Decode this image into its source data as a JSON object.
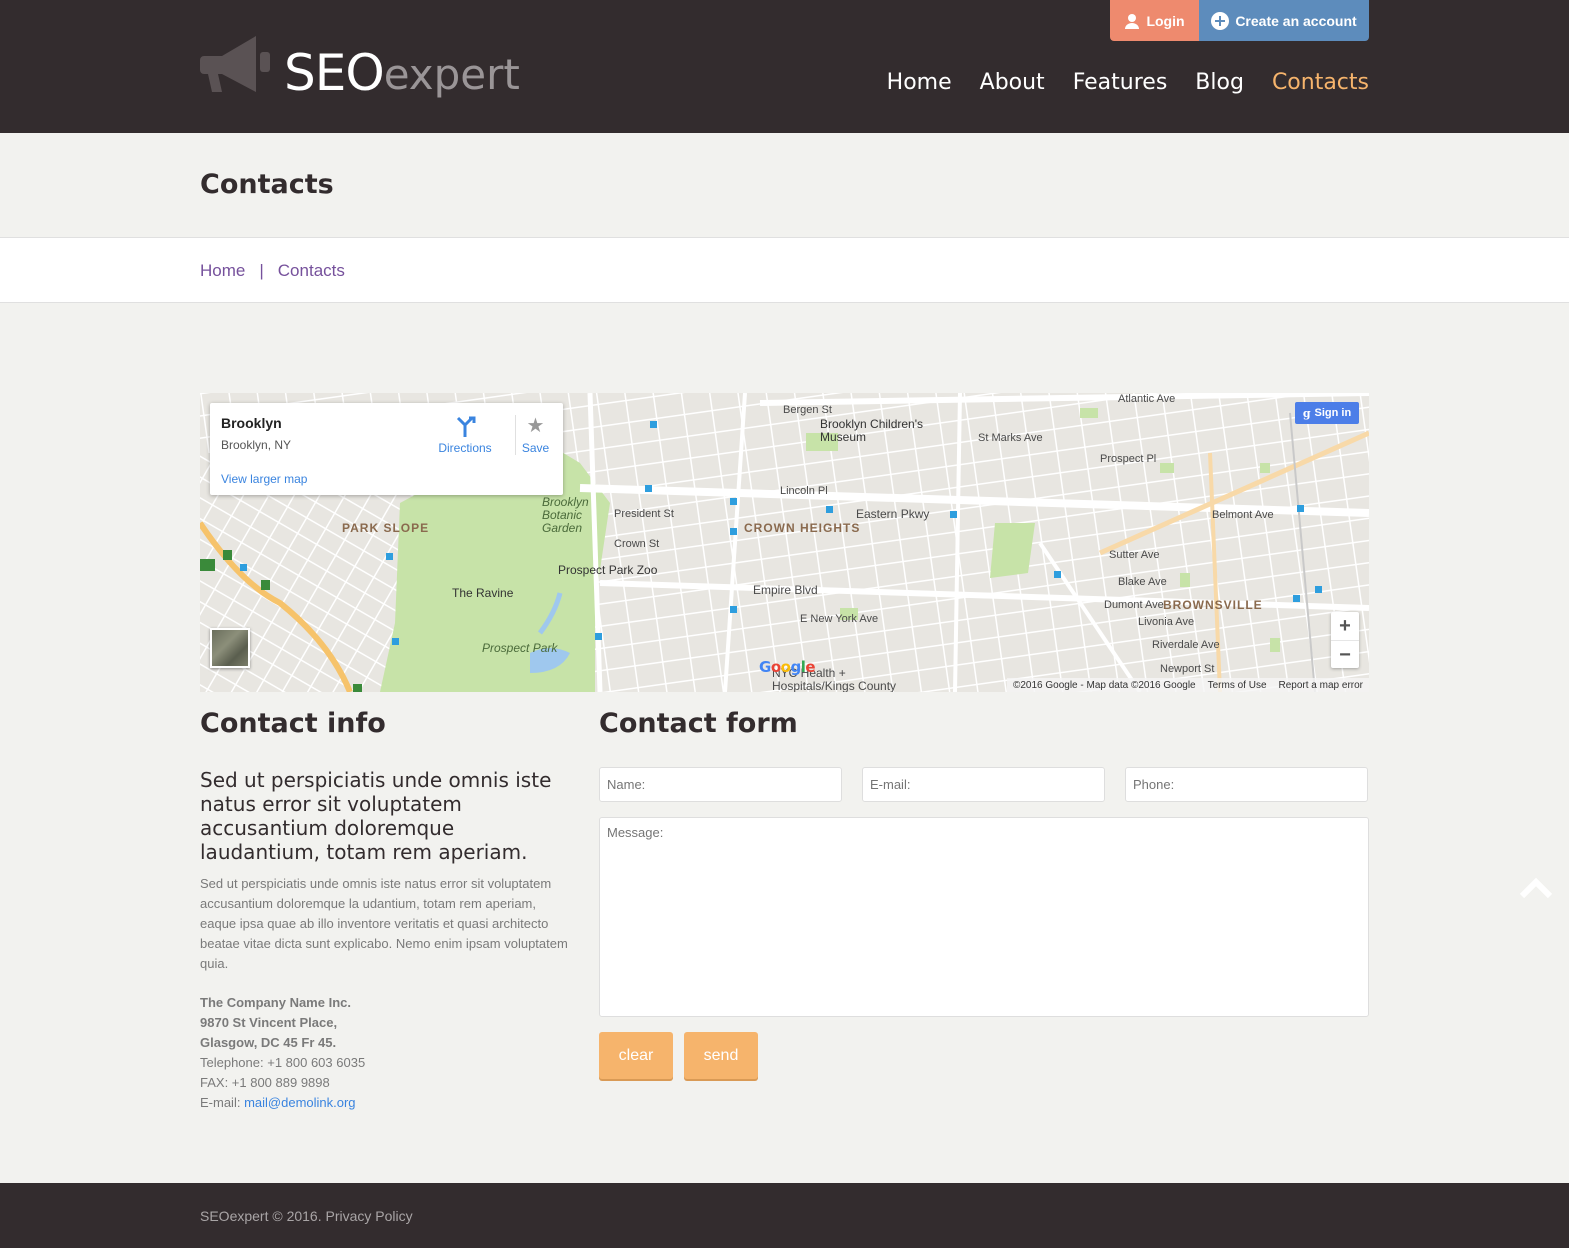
{
  "header": {
    "logo_main": "SEO",
    "logo_sub": "expert",
    "login_label": "Login",
    "create_account_label": "Create an account",
    "nav": [
      "Home",
      "About",
      "Features",
      "Blog",
      "Contacts"
    ],
    "active_nav": "Contacts",
    "colors": {
      "bg": "#332c2e",
      "active": "#f6b46c",
      "login": "#ee8a6e",
      "create": "#5d8cbc"
    }
  },
  "page": {
    "title": "Contacts",
    "breadcrumb": [
      "Home",
      "Contacts"
    ],
    "breadcrumb_separator": "|"
  },
  "map": {
    "place_title": "Brooklyn",
    "place_subtitle": "Brooklyn, NY",
    "directions_label": "Directions",
    "save_label": "Save",
    "larger_map_label": "View larger map",
    "signin_label": "Sign in",
    "zoom_in": "+",
    "zoom_out": "−",
    "google_logo": "Google",
    "attribution": "©2016 Google - Map data ©2016 Google",
    "terms": "Terms of Use",
    "report": "Report a map error",
    "labels": {
      "park_slope": "PARK SLOPE",
      "crown_heights": "CROWN HEIGHTS",
      "brownsville": "BROWNSVILLE",
      "prospect_park": "Prospect Park",
      "prospect_park_zoo": "Prospect Park Zoo",
      "the_ravine": "The Ravine",
      "botanic_garden": "Brooklyn Botanic Garden",
      "childrens_museum": "Brooklyn Children's Museum",
      "eastern_pkwy": "Eastern Pkwy",
      "empire_blvd": "Empire Blvd",
      "atlantic_ave": "Atlantic Ave",
      "lincoln_pl": "Lincoln Pl",
      "st_marks_ave": "St Marks Ave",
      "prospect_pl": "Prospect Pl",
      "sutter_ave": "Sutter Ave",
      "blake_ave": "Blake Ave",
      "dumont_ave": "Dumont Ave",
      "livonia_ave": "Livonia Ave",
      "riverdale_ave": "Riverdale Ave",
      "belmont_ave": "Belmont Ave",
      "e_new_york_ave": "E New York Ave",
      "nyc_health": "NYC Health + Hospitals/Kings County",
      "newport_st": "Newport St",
      "bergen_st": "Bergen St",
      "president_st": "President St",
      "crown_st": "Crown St"
    }
  },
  "contact_info": {
    "heading": "Contact info",
    "lead": "Sed ut perspiciatis unde omnis iste natus error sit voluptatem accusantium doloremque laudantium, totam rem aperiam.",
    "body": "Sed ut perspiciatis unde omnis iste natus error sit voluptatem accusantium doloremque la udantium, totam rem aperiam, eaque ipsa quae ab illo inventore veritatis et quasi architecto beatae vitae dicta sunt explicabo. Nemo enim ipsam voluptatem quia.",
    "company": "The Company Name Inc.",
    "address_line1": "9870 St Vincent Place,",
    "address_line2": "Glasgow, DC 45 Fr 45.",
    "telephone": "Telephone: +1 800 603 6035",
    "fax": "FAX: +1 800 889 9898",
    "email_label": "E-mail:",
    "email": "mail@demolink.org"
  },
  "contact_form": {
    "heading": "Contact form",
    "name_placeholder": "Name:",
    "email_placeholder": "E-mail:",
    "phone_placeholder": "Phone:",
    "message_placeholder": "Message:",
    "clear_label": "clear",
    "send_label": "send"
  },
  "footer": {
    "copyright": "SEOexpert © 2016.",
    "privacy": "Privacy Policy"
  }
}
